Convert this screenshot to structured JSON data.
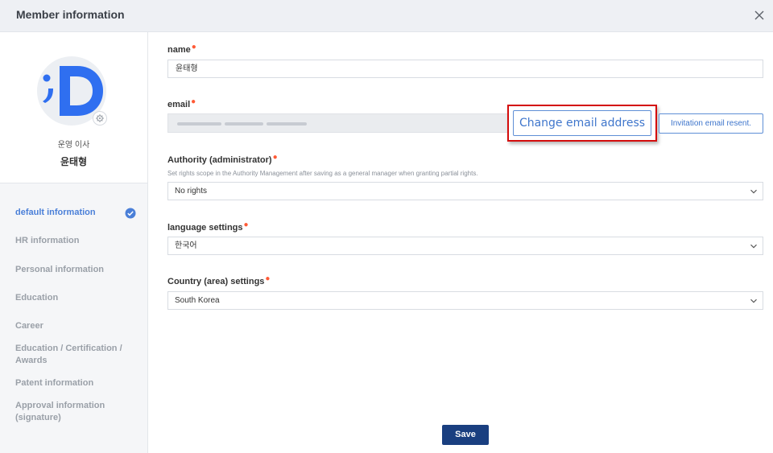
{
  "header": {
    "title": "Member information"
  },
  "profile": {
    "role": "운영 이사",
    "name": "윤태형"
  },
  "sidebar": {
    "items": [
      {
        "label": "default information"
      },
      {
        "label": "HR information"
      },
      {
        "label": "Personal information"
      },
      {
        "label": "Education"
      },
      {
        "label": "Career"
      },
      {
        "label": "Education / Certification / Awards"
      },
      {
        "label": "Patent information"
      },
      {
        "label": "Approval information (signature)"
      }
    ]
  },
  "form": {
    "name": {
      "label": "name",
      "value": "윤태형"
    },
    "email": {
      "label": "email",
      "change_label": "Change email address",
      "resend_label": "Invitation email resent."
    },
    "authority": {
      "label": "Authority (administrator)",
      "hint": "Set rights scope in the Authority Management after saving as a general manager when granting partial rights.",
      "value": "No rights"
    },
    "language": {
      "label": "language settings",
      "value": "한국어"
    },
    "country": {
      "label": "Country (area) settings",
      "value": "South Korea"
    }
  },
  "footer": {
    "save_label": "Save"
  },
  "colors": {
    "accent": "#4a7fd8",
    "primary_button": "#1a3f80",
    "required": "#ff5a36",
    "highlight": "#d40c0c"
  }
}
